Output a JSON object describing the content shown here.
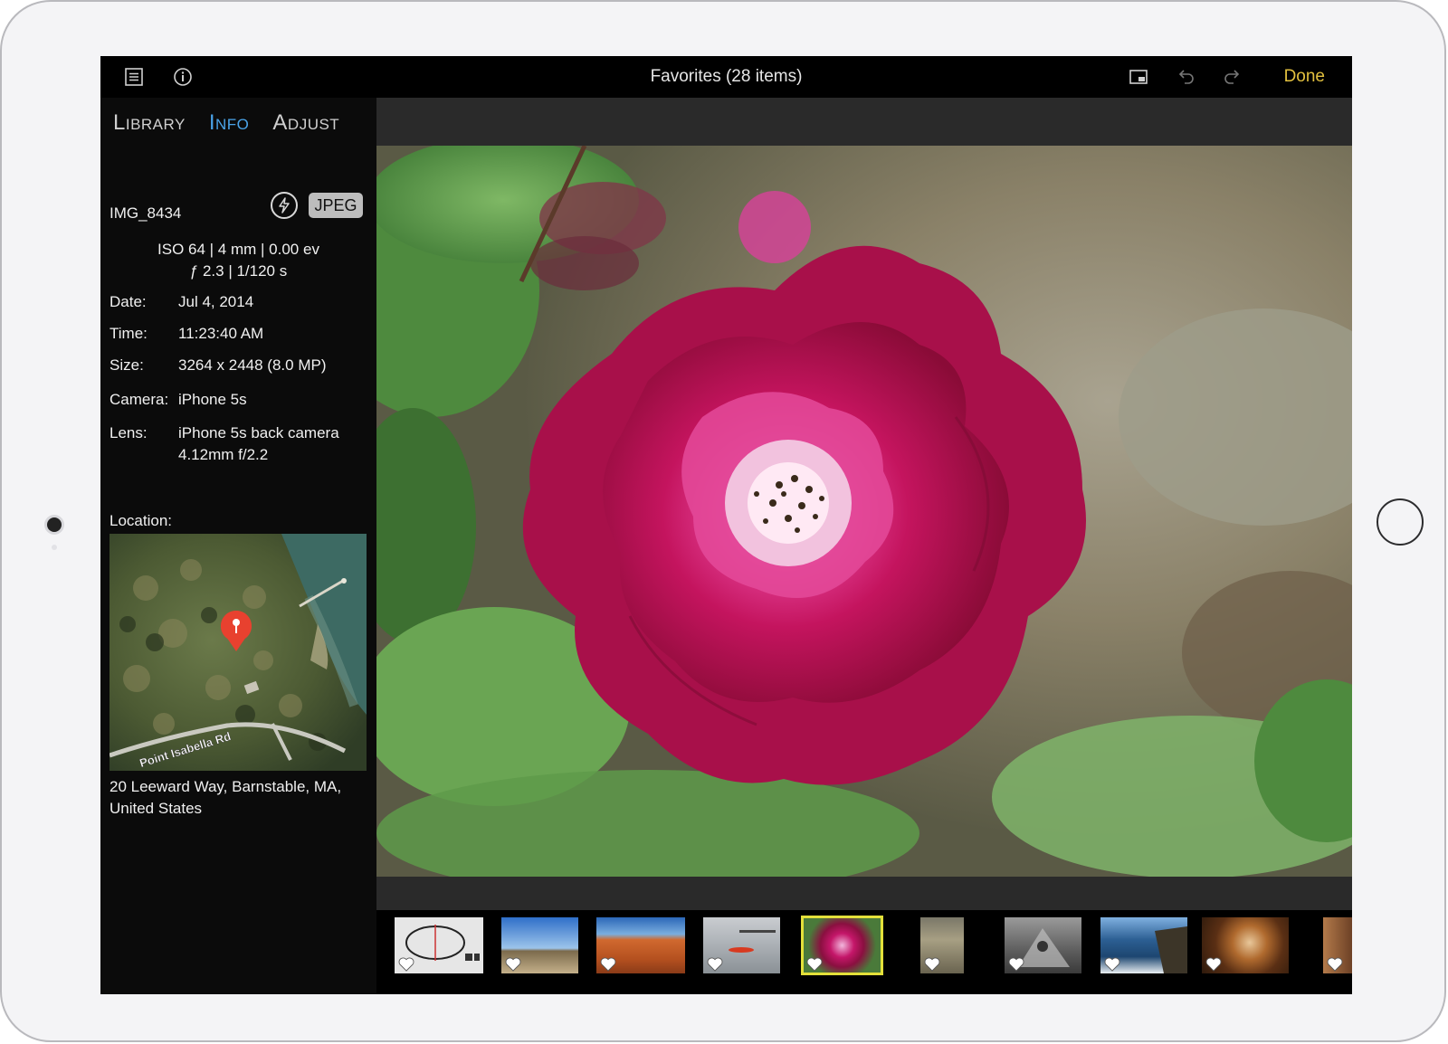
{
  "topbar": {
    "title": "Favorites (28 items)",
    "done_label": "Done",
    "icons": [
      "list-icon",
      "info-icon",
      "picture-in-picture-icon",
      "undo-icon",
      "redo-icon"
    ]
  },
  "sidebar": {
    "tabs": [
      {
        "label": "Library",
        "active": false
      },
      {
        "label": "Info",
        "active": true
      },
      {
        "label": "Adjust",
        "active": false
      }
    ],
    "filename": "IMG_8434",
    "format_badge": "JPEG",
    "exif_line1": "ISO 64 | 4 mm | 0.00 ev",
    "exif_line2": "ƒ 2.3 | 1/120 s",
    "fields": {
      "date_label": "Date:",
      "date_value": "Jul 4, 2014",
      "time_label": "Time:",
      "time_value": "11:23:40 AM",
      "size_label": "Size:",
      "size_value": "3264 x 2448 (8.0 MP)",
      "camera_label": "Camera:",
      "camera_value": "iPhone 5s",
      "lens_label": "Lens:",
      "lens_value_line1": "iPhone 5s back camera",
      "lens_value_line2": "4.12mm f/2.2"
    },
    "location_label": "Location:",
    "map_road_label": "Point Isabella Rd",
    "address_line1": "20 Leeward Way, Barnstable, MA,",
    "address_line2": "United States"
  },
  "colors": {
    "accent_tab": "#4aa3e8",
    "done": "#e3c13f",
    "selection": "#e3e03a"
  },
  "filmstrip": {
    "thumbs": [
      {
        "name": "thumb-diagram",
        "favorite": true,
        "selected": false
      },
      {
        "name": "thumb-beach-people",
        "favorite": true,
        "selected": false
      },
      {
        "name": "thumb-canyon",
        "favorite": true,
        "selected": false
      },
      {
        "name": "thumb-harbor-kayak",
        "favorite": true,
        "selected": false
      },
      {
        "name": "thumb-rose",
        "favorite": true,
        "selected": true
      },
      {
        "name": "thumb-carving",
        "favorite": true,
        "selected": false
      },
      {
        "name": "thumb-tent-bw",
        "favorite": true,
        "selected": false
      },
      {
        "name": "thumb-ocean-rocks",
        "favorite": true,
        "selected": false
      },
      {
        "name": "thumb-nautilus",
        "favorite": true,
        "selected": false
      },
      {
        "name": "thumb-partial",
        "favorite": true,
        "selected": false
      }
    ]
  }
}
